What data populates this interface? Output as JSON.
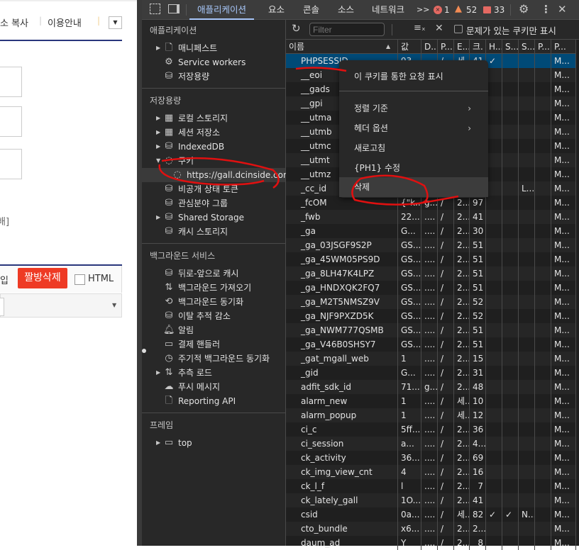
{
  "page": {
    "links": [
      "소 복사",
      "이용안내"
    ],
    "bracket_text": "배]",
    "toolbar_prefix": "입",
    "delete_button": "짤방삭제",
    "html_checkbox": "HTML",
    "delete_button_color": "#ee3a24",
    "navy": "#29367c"
  },
  "devtools": {
    "tabs": [
      "애플리케이션",
      "요소",
      "콘솔",
      "소스",
      "네트워크"
    ],
    "more": ">>",
    "badges": {
      "errors": "1",
      "warnings": "52",
      "info": "33"
    },
    "filter_placeholder": "Filter",
    "only_issues_label": "문제가 있는 쿠키만 표시",
    "sidebar": {
      "sections": [
        {
          "title": "애플리케이션",
          "items": [
            {
              "label": "매니페스트",
              "icon": "file-icon",
              "arrow": true
            },
            {
              "label": "Service workers",
              "icon": "gears-icon"
            },
            {
              "label": "저장용량",
              "icon": "database-icon"
            }
          ]
        },
        {
          "title": "저장용량",
          "items": [
            {
              "label": "로컬 스토리지",
              "icon": "table-icon",
              "arrow": true
            },
            {
              "label": "세션 저장소",
              "icon": "table-icon",
              "arrow": true
            },
            {
              "label": "IndexedDB",
              "icon": "database-icon",
              "arrow": true
            },
            {
              "label": "쿠키",
              "icon": "cookie-icon",
              "expanded": true
            },
            {
              "label": "https://gall.dcinside.com",
              "icon": "cookie-icon",
              "child": true,
              "selected": true
            },
            {
              "label": "비공개 상태 토큰",
              "icon": "database-icon"
            },
            {
              "label": "관심분야 그룹",
              "icon": "database-icon"
            },
            {
              "label": "Shared Storage",
              "icon": "database-icon",
              "arrow": true
            },
            {
              "label": "캐시 스토리지",
              "icon": "database-icon"
            }
          ]
        },
        {
          "title": "백그라운드 서비스",
          "items": [
            {
              "label": "뒤로-앞으로 캐시",
              "icon": "database-icon"
            },
            {
              "label": "백그라운드 가져오기",
              "icon": "arrows-updown-icon"
            },
            {
              "label": "백그라운드 동기화",
              "icon": "sync-icon"
            },
            {
              "label": "이탈 추적 감소",
              "icon": "database-icon"
            },
            {
              "label": "알림",
              "icon": "bell-icon"
            },
            {
              "label": "결제 핸들러",
              "icon": "card-icon"
            },
            {
              "label": "주기적 백그라운드 동기화",
              "icon": "clock-icon"
            },
            {
              "label": "추측 로드",
              "icon": "arrows-updown-icon",
              "arrow": true
            },
            {
              "label": "푸시 메시지",
              "icon": "cloud-icon"
            },
            {
              "label": "Reporting API",
              "icon": "file-icon"
            }
          ]
        },
        {
          "title": "프레임",
          "items": [
            {
              "label": "top",
              "icon": "frame-icon",
              "arrow": true
            }
          ]
        }
      ]
    },
    "columns": [
      "이름",
      "값",
      "D..",
      "P...",
      "E...",
      "크.",
      "H...",
      "S...",
      "S...",
      "P...",
      "P..."
    ],
    "rows": [
      [
        "PHPSESSID",
        "93",
        "",
        "/",
        "세",
        "41",
        "✓",
        "",
        "",
        "",
        "M..."
      ],
      [
        "__eoi",
        "",
        "",
        "",
        "",
        "",
        "",
        "",
        "",
        "",
        "M..."
      ],
      [
        "__gads",
        "",
        "",
        "",
        "",
        "",
        "",
        "",
        "",
        "",
        "M..."
      ],
      [
        "__gpi",
        "",
        "",
        "",
        "",
        "",
        "",
        "",
        "",
        "",
        "M..."
      ],
      [
        "__utma",
        "",
        "",
        "",
        "",
        "",
        "",
        "",
        "",
        "",
        "M..."
      ],
      [
        "__utmb",
        "",
        "",
        "",
        "",
        "",
        "",
        "",
        "",
        "",
        "M..."
      ],
      [
        "__utmc",
        "",
        "",
        "",
        "",
        "",
        "",
        "",
        "",
        "",
        "M..."
      ],
      [
        "__utmt",
        "",
        "",
        "",
        "",
        "",
        "",
        "",
        "",
        "",
        "M..."
      ],
      [
        "__utmz",
        "",
        "",
        "",
        "",
        "",
        "",
        "",
        "",
        "",
        "M..."
      ],
      [
        "_cc_id",
        "",
        "",
        "",
        "",
        "",
        "",
        "",
        "L...",
        "",
        "M..."
      ],
      [
        "_fcOM",
        "{\"k...",
        "g...",
        "/",
        "2...",
        "97",
        "",
        "",
        "",
        "",
        "M..."
      ],
      [
        "_fwb",
        "22...",
        "....",
        "/",
        "2...",
        "41",
        "",
        "",
        "",
        "",
        "M..."
      ],
      [
        "_ga",
        "G...",
        "....",
        "/",
        "2...",
        "30",
        "",
        "",
        "",
        "",
        "M..."
      ],
      [
        "_ga_03JSGF9S2P",
        "GS...",
        "....",
        "/",
        "2...",
        "51",
        "",
        "",
        "",
        "",
        "M..."
      ],
      [
        "_ga_45WM05PS9D",
        "GS...",
        "....",
        "/",
        "2...",
        "51",
        "",
        "",
        "",
        "",
        "M..."
      ],
      [
        "_ga_8LH47K4LPZ",
        "GS...",
        "....",
        "/",
        "2...",
        "51",
        "",
        "",
        "",
        "",
        "M..."
      ],
      [
        "_ga_HNDXQK2FQ7",
        "GS...",
        "....",
        "/",
        "2...",
        "51",
        "",
        "",
        "",
        "",
        "M..."
      ],
      [
        "_ga_M2T5NMSZ9V",
        "GS...",
        "....",
        "/",
        "2...",
        "52",
        "",
        "",
        "",
        "",
        "M..."
      ],
      [
        "_ga_NJF9PXZD5K",
        "GS...",
        "....",
        "/",
        "2...",
        "52",
        "",
        "",
        "",
        "",
        "M..."
      ],
      [
        "_ga_NWM777QSMB",
        "GS...",
        "....",
        "/",
        "2...",
        "51",
        "",
        "",
        "",
        "",
        "M..."
      ],
      [
        "_ga_V46B0SHSY7",
        "GS...",
        "....",
        "/",
        "2...",
        "51",
        "",
        "",
        "",
        "",
        "M..."
      ],
      [
        "_gat_mgall_web",
        "1",
        "....",
        "/",
        "2...",
        "15",
        "",
        "",
        "",
        "",
        "M..."
      ],
      [
        "_gid",
        "G...",
        "....",
        "/",
        "2...",
        "31",
        "",
        "",
        "",
        "",
        "M..."
      ],
      [
        "adfit_sdk_id",
        "71...",
        "g...",
        "/",
        "2...",
        "48",
        "",
        "",
        "",
        "",
        "M..."
      ],
      [
        "alarm_new",
        "1",
        "....",
        "/",
        "세...",
        "10",
        "",
        "",
        "",
        "",
        "M..."
      ],
      [
        "alarm_popup",
        "1",
        "....",
        "/",
        "세...",
        "12",
        "",
        "",
        "",
        "",
        "M..."
      ],
      [
        "ci_c",
        "5ff...",
        "....",
        "/",
        "2...",
        "36",
        "",
        "",
        "",
        "",
        "M..."
      ],
      [
        "ci_session",
        "a...",
        "....",
        "/",
        "2...",
        "4...",
        "",
        "",
        "",
        "",
        "M..."
      ],
      [
        "ck_activity",
        "36...",
        "....",
        "/",
        "2...",
        "69",
        "",
        "",
        "",
        "",
        "M..."
      ],
      [
        "ck_img_view_cnt",
        "4",
        "....",
        "/",
        "2...",
        "16",
        "",
        "",
        "",
        "",
        "M..."
      ],
      [
        "ck_l_f",
        "l",
        "....",
        "/",
        "2...",
        "7",
        "",
        "",
        "",
        "",
        "M..."
      ],
      [
        "ck_lately_gall",
        "1O...",
        "....",
        "/",
        "2...",
        "41",
        "",
        "",
        "",
        "",
        "M..."
      ],
      [
        "csid",
        "0a...",
        "....",
        "/",
        "세...",
        "82",
        "✓",
        "✓",
        "N...",
        "",
        "M..."
      ],
      [
        "cto_bundle",
        "x6...",
        "....",
        "/",
        "2...",
        "2...",
        "",
        "",
        "",
        "",
        "M..."
      ],
      [
        "daum_ad",
        "Y",
        "....",
        "/",
        "2...",
        "8",
        "",
        "",
        "",
        "",
        "M..."
      ]
    ],
    "context_menu": [
      {
        "label": "이 쿠키를 통한 요청 표시"
      },
      {
        "label": "정렬 기준",
        "submenu": true
      },
      {
        "label": "헤더 옵션",
        "submenu": true
      },
      {
        "label": "새로고침"
      },
      {
        "label": "{PH1} 수정"
      },
      {
        "label": "삭제",
        "highlighted": true
      }
    ],
    "colors": {
      "accent": "#a8c7fa",
      "selected_row": "#004a77",
      "annotation": "#e01010"
    }
  }
}
